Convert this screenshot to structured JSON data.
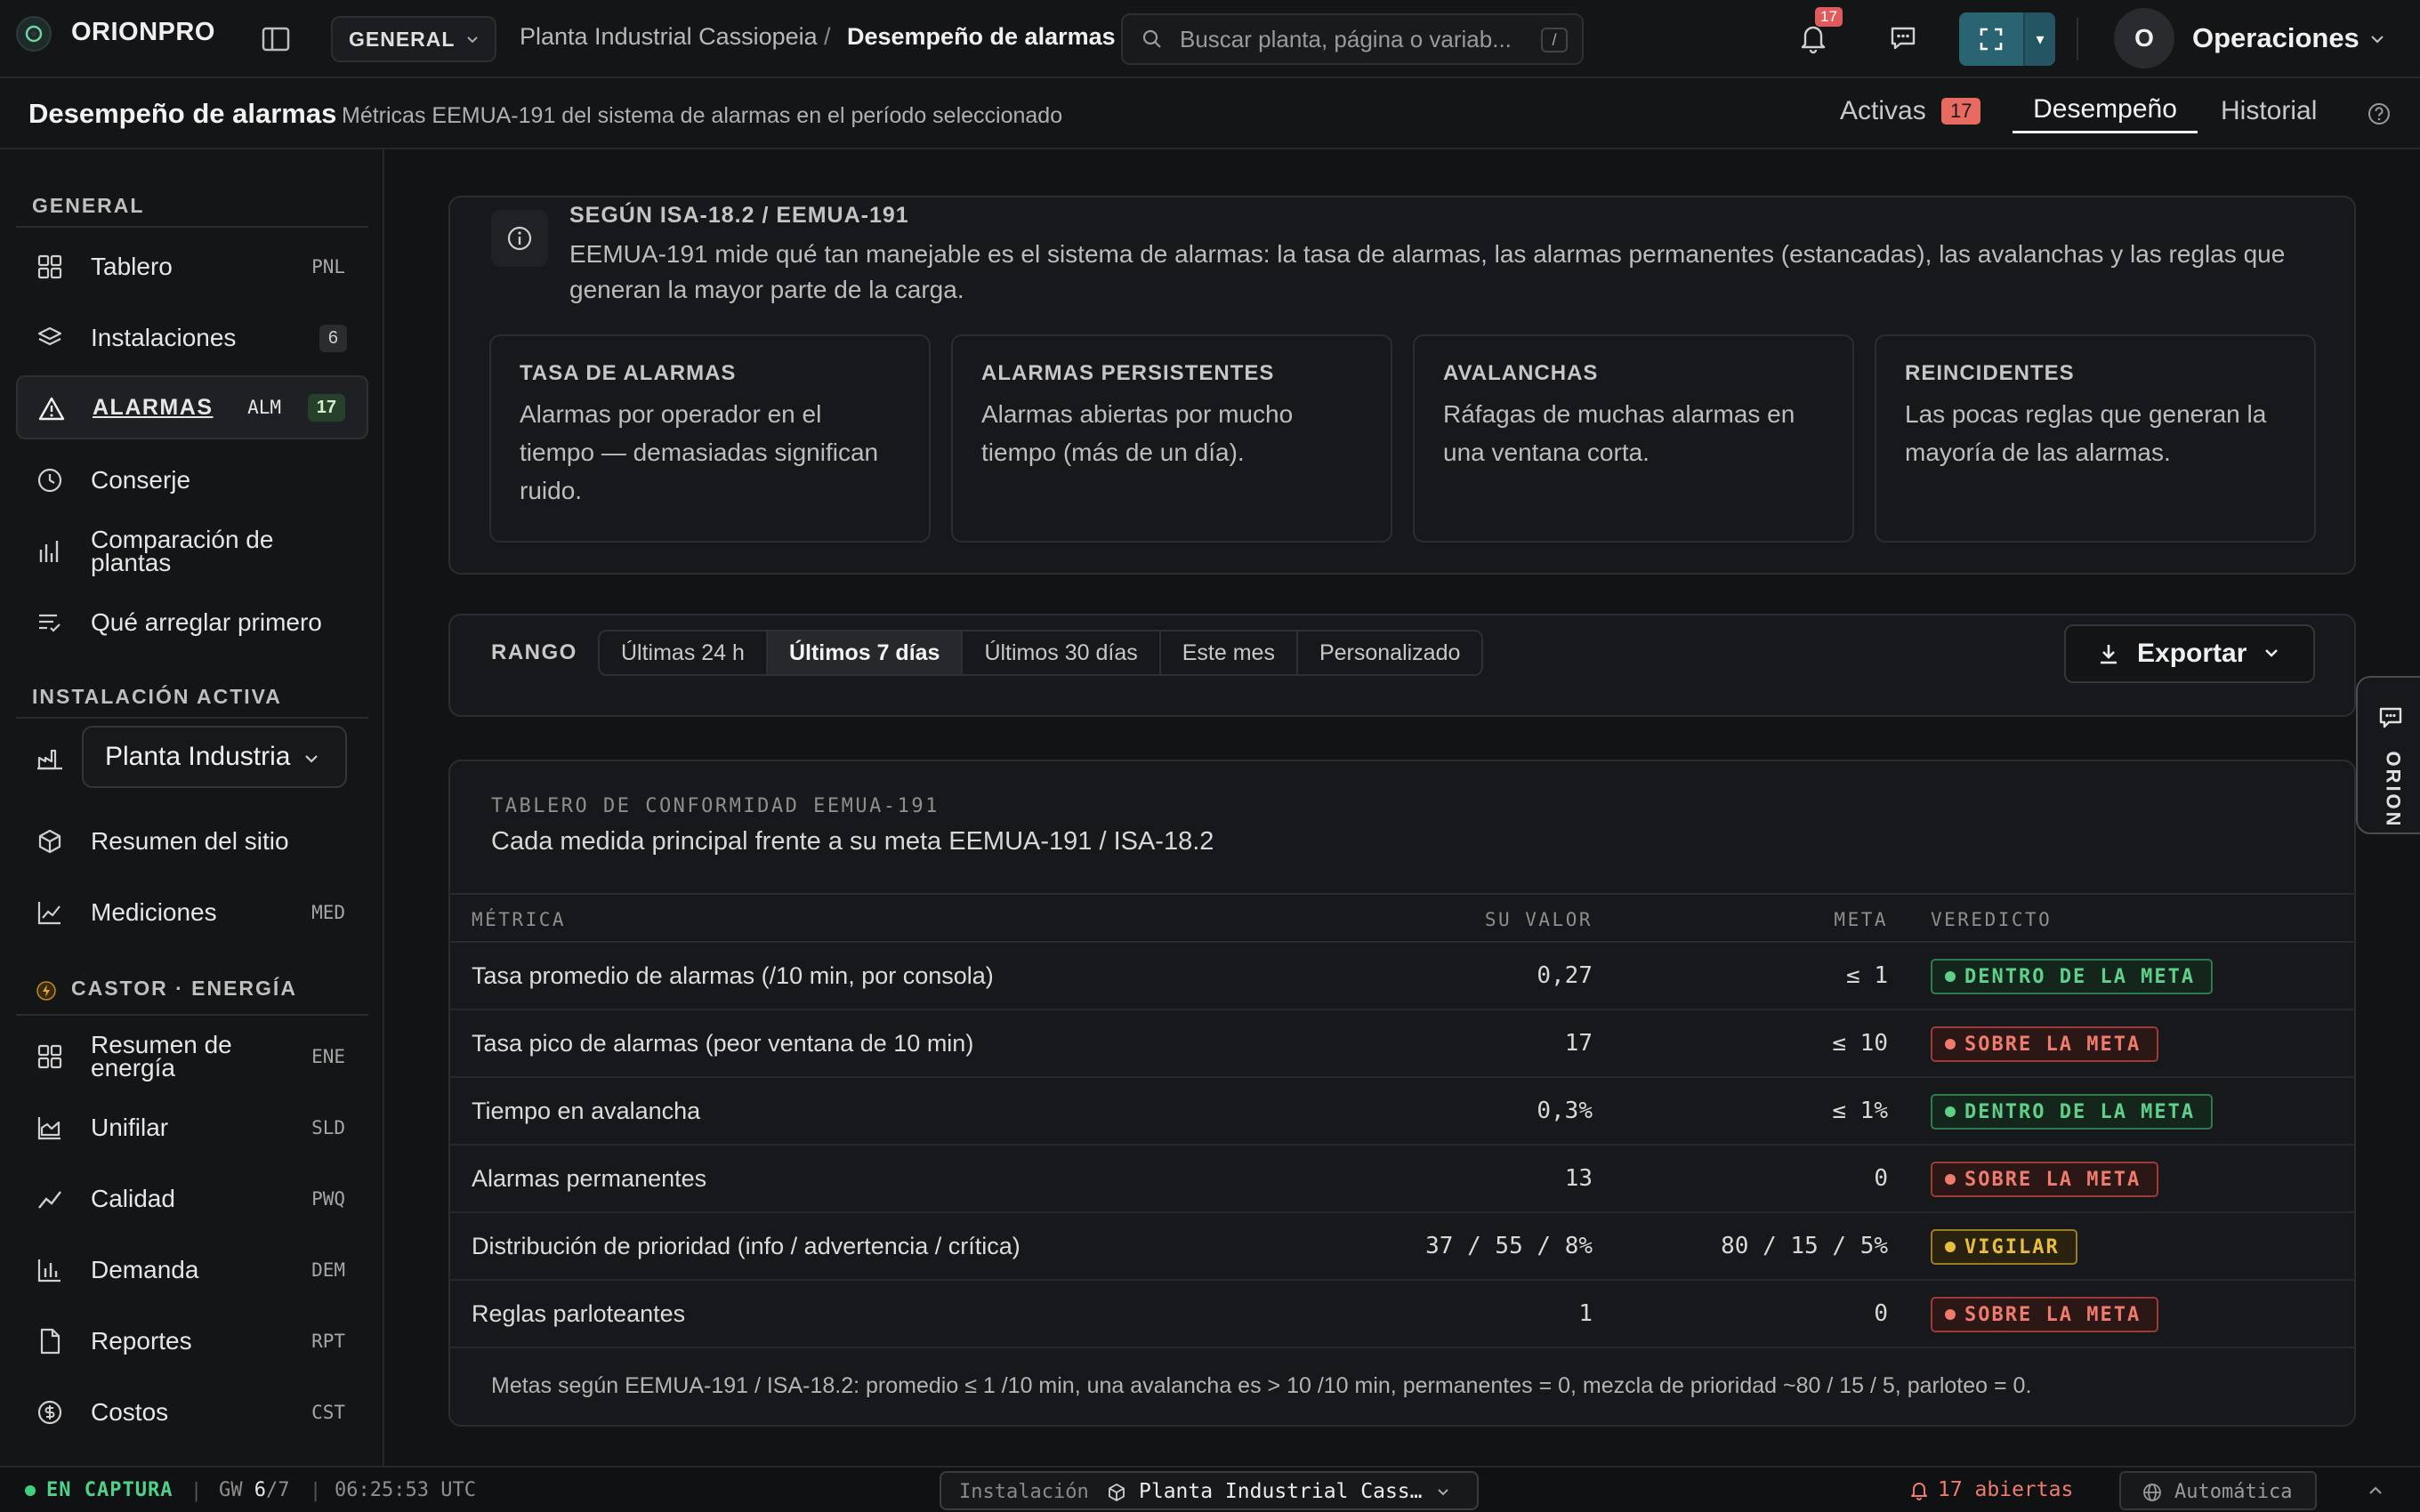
{
  "app": {
    "name": "ORIONPRO"
  },
  "topbar": {
    "workspace": "GENERAL",
    "breadcrumb": [
      "Planta Industrial Cassiopeia",
      "Desempeño de alarmas"
    ],
    "breadcrumb_sep": "/",
    "search_placeholder": "Buscar planta, página o variab...",
    "search_shortcut": "/",
    "notification_count": "17",
    "user_initial": "O",
    "user_name": "Operaciones"
  },
  "subheader": {
    "title": "Desempeño de alarmas",
    "subtitle": "Métricas EEMUA-191 del sistema de alarmas en el período seleccionado",
    "tabs": {
      "active_label": "Activas",
      "active_count": "17",
      "performance": "Desempeño",
      "history": "Historial"
    }
  },
  "sidebar": {
    "general_label": "GENERAL",
    "general_items": [
      {
        "label": "Tablero",
        "code": "PNL"
      },
      {
        "label": "Instalaciones",
        "count": "6"
      },
      {
        "label": "ALARMAS",
        "code": "ALM",
        "count": "17"
      },
      {
        "label": "Conserje"
      },
      {
        "label": "Comparación de plantas"
      },
      {
        "label": "Qué arreglar primero"
      }
    ],
    "active_install_label": "INSTALACIÓN ACTIVA",
    "plant_select": "Planta Industrial Cassiopeia",
    "site_items": [
      {
        "label": "Resumen del sitio"
      },
      {
        "label": "Mediciones",
        "code": "MED"
      }
    ],
    "energy_label": "CASTOR · ENERGÍA",
    "energy_items": [
      {
        "label": "Resumen de energía",
        "code": "ENE"
      },
      {
        "label": "Unifilar",
        "code": "SLD"
      },
      {
        "label": "Calidad",
        "code": "PWQ"
      },
      {
        "label": "Demanda",
        "code": "DEM"
      },
      {
        "label": "Reportes",
        "code": "RPT"
      },
      {
        "label": "Costos",
        "code": "CST"
      }
    ]
  },
  "info": {
    "title": "SEGÚN ISA-18.2 / EEMUA-191",
    "body": "EEMUA-191 mide qué tan manejable es el sistema de alarmas: la tasa de alarmas, las alarmas permanentes (estancadas), las avalanchas y las reglas que generan la mayor parte de la carga.",
    "cards": [
      {
        "title": "TASA DE ALARMAS",
        "body": "Alarmas por operador en el tiempo — demasiadas significan ruido."
      },
      {
        "title": "ALARMAS PERSISTENTES",
        "body": "Alarmas abiertas por mucho tiempo (más de un día)."
      },
      {
        "title": "AVALANCHAS",
        "body": "Ráfagas de muchas alarmas en una ventana corta."
      },
      {
        "title": "REINCIDENTES",
        "body": "Las pocas reglas que generan la mayoría de las alarmas."
      }
    ]
  },
  "range": {
    "label": "RANGO",
    "options": [
      "Últimas 24 h",
      "Últimos 7 días",
      "Últimos 30 días",
      "Este mes",
      "Personalizado"
    ],
    "selected": "Últimos 7 días",
    "export_label": "Exportar"
  },
  "scorecard": {
    "eyebrow": "TABLERO DE CONFORMIDAD EEMUA-191",
    "title": "Cada medida principal frente a su meta EEMUA-191 / ISA-18.2",
    "headers": {
      "metric": "MÉTRICA",
      "value": "SU VALOR",
      "goal": "META",
      "verdict": "VEREDICTO"
    },
    "rows": [
      {
        "metric": "Tasa promedio de alarmas (/10 min, por consola)",
        "value": "0,27",
        "goal": "≤ 1",
        "verdict": "DENTRO DE LA META",
        "status": "ok"
      },
      {
        "metric": "Tasa pico de alarmas (peor ventana de 10 min)",
        "value": "17",
        "goal": "≤ 10",
        "verdict": "SOBRE LA META",
        "status": "bad"
      },
      {
        "metric": "Tiempo en avalancha",
        "value": "0,3%",
        "goal": "≤ 1%",
        "verdict": "DENTRO DE LA META",
        "status": "ok"
      },
      {
        "metric": "Alarmas permanentes",
        "value": "13",
        "goal": "0",
        "verdict": "SOBRE LA META",
        "status": "bad"
      },
      {
        "metric": "Distribución de prioridad (info / advertencia / crítica)",
        "value": "37 / 55 / 8%",
        "goal": "80 / 15 / 5%",
        "verdict": "VIGILAR",
        "status": "warn"
      },
      {
        "metric": "Reglas parloteantes",
        "value": "1",
        "goal": "0",
        "verdict": "SOBRE LA META",
        "status": "bad"
      }
    ],
    "footnote": "Metas según EEMUA-191 / ISA-18.2: promedio ≤ 1 /10 min, una avalancha es > 10 /10 min, permanentes = 0, mezcla de prioridad ~80 / 15 / 5, parloteo = 0."
  },
  "orion_tab": "ORION",
  "statusbar": {
    "capture": "EN CAPTURA",
    "gw_label": "GW",
    "gw_value": "6",
    "gw_total": "/7",
    "time": "06:25:53 UTC",
    "inst_label": "Instalación",
    "inst_value": "Planta Industrial Cass…",
    "open_alarms": "17 abiertas",
    "mode": "Automática"
  },
  "colors": {
    "accent": "#2a6371",
    "ok": "#5fd08a",
    "bad": "#ef7b6e",
    "warn": "#e8be40"
  }
}
